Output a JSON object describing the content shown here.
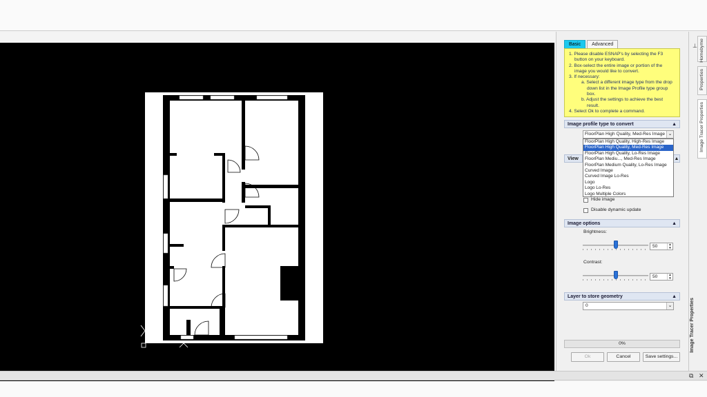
{
  "panel": {
    "tabs": [
      {
        "label": "Basic",
        "active": true
      },
      {
        "label": "Advanced",
        "active": false
      }
    ],
    "instructions": [
      {
        "level": 1,
        "text": "1. Please disable ESNAP's by selecting the F3 button on your keyboard."
      },
      {
        "level": 1,
        "text": "2. Box-select the entire image or portion of the image you would like to convert."
      },
      {
        "level": 1,
        "text": "3. If necessary:"
      },
      {
        "level": 2,
        "text": "a. Select a different image type from the drop down list in the Image Profile type group box."
      },
      {
        "level": 2,
        "text": "b. Adjust the settings to achieve the best result."
      },
      {
        "level": 1,
        "text": "4. Select Ok to complete a command."
      }
    ],
    "profile_section": {
      "title": "Image profile type to convert",
      "selected_value": "FloorPlan High Quality, Med-Res Image",
      "options": [
        "FloorPlan High Quality, High-Res Image",
        "FloorPlan High Quality, Med-Res Image",
        "FloorPlan High Quality, Lo-Res Image",
        "FloorPlan Mediu..., Med-Res Image",
        "FloorPlan Medium Quality, Lo-Res Image",
        "Curved Image",
        "Curved Image Lo-Res",
        "Logo",
        "Logo Lo-Res",
        "Logo Multiple Colors"
      ],
      "highlighted_index": 1
    },
    "view_section": {
      "title": "View o",
      "hide_image_label": "Hide image",
      "disable_update_label": "Disable dynamic update"
    },
    "image_options": {
      "title": "Image options",
      "brightness_label": "Brightness:",
      "brightness_value": "50",
      "brightness_fraction": 0.5,
      "contrast_label": "Contrast:",
      "contrast_value": "50",
      "contrast_fraction": 0.5
    },
    "layer_section": {
      "title": "Layer to store geometry",
      "value": "0"
    },
    "progress_text": "0%",
    "buttons": {
      "ok": "Ok",
      "cancel": "Cancel",
      "save": "Save settings..."
    },
    "side_tabs": [
      "Homebyme",
      "Properties",
      "Image Tracer Properties"
    ],
    "side_title": "Image Tracer Properties"
  },
  "colors": {
    "tab_active": "#1cc8ee",
    "instructions_bg": "#fffe7c",
    "selection": "#2a64c8",
    "slider_thumb": "#2a72d8"
  }
}
